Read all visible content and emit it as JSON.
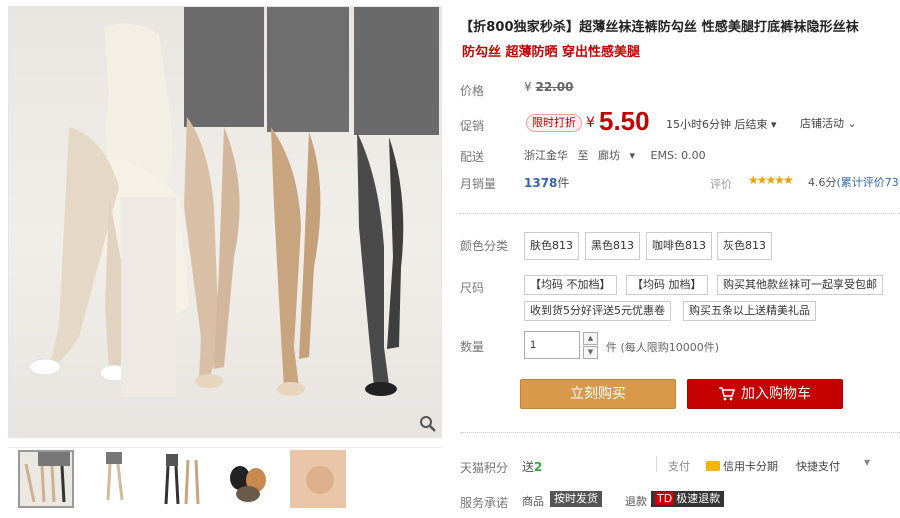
{
  "product": {
    "title": "【折800独家秒杀】超薄丝袜连裤防勾丝 性感美腿打底裤袜隐形丝袜",
    "subtitle": "防勾丝 超薄防晒 穿出性感美腿"
  },
  "price": {
    "label": "价格",
    "original_currency": "¥",
    "original_value": "22.00"
  },
  "promo": {
    "label": "促销",
    "tag": "限时打折",
    "currency": "¥",
    "value": "5.50",
    "countdown": "15小时6分钟 后结束",
    "countdown_arrow": "▾",
    "shop_activity": "店铺活动",
    "shop_activity_arrow": "⌄"
  },
  "shipping": {
    "label": "配送",
    "from": "浙江金华",
    "to_word": "至",
    "dest": "廊坊",
    "dest_arrow": "▾",
    "method": "EMS: 0.00"
  },
  "sales": {
    "label": "月销量",
    "count": "1378",
    "unit": "件"
  },
  "reviews": {
    "label": "评价",
    "stars": "★★★★★",
    "score": "4.6分",
    "link": "(累计评价73)"
  },
  "colors": {
    "label": "颜色分类",
    "options": [
      "肤色813",
      "黑色813",
      "咖啡色813",
      "灰色813"
    ]
  },
  "sizes": {
    "label": "尺码",
    "options": [
      "【均码 不加档】",
      "【均码 加档】",
      "购买其他款丝袜可一起享受包邮",
      "收到货5分好评送5元优惠卷",
      "购买五条以上送精美礼品"
    ]
  },
  "quantity": {
    "label": "数量",
    "value": "1",
    "up": "▲",
    "down": "▼",
    "note": "件 (每人限购10000件)"
  },
  "actions": {
    "buy": "立刻购买",
    "cart": "加入购物车"
  },
  "points": {
    "label": "天猫积分",
    "prefix": "送",
    "value": "2"
  },
  "payment": {
    "label": "支付",
    "credit": "信用卡分期",
    "quick": "快捷支付",
    "more": "▼"
  },
  "service": {
    "label": "服务承诺",
    "item1_label": "商品",
    "item1_tag": "按时发货",
    "item2_label": "退款",
    "item2_badge": "TD",
    "item2_tag": "极速退款"
  },
  "colors_theme": {
    "price_red": "#c40000",
    "buy_orange": "#d89a4a",
    "cart_red": "#c40000",
    "link_blue": "#3366aa",
    "star_gold": "#f0a000"
  }
}
